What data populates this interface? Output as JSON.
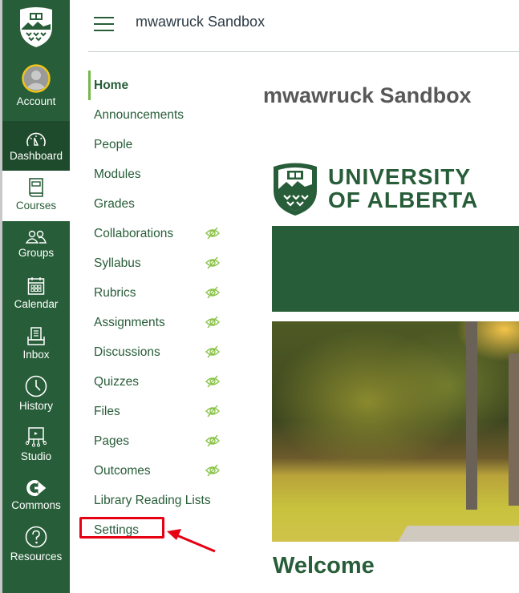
{
  "global_nav": {
    "items": [
      {
        "label": "Account",
        "icon": "avatar-icon"
      },
      {
        "label": "Dashboard",
        "icon": "dashboard-icon"
      },
      {
        "label": "Courses",
        "icon": "courses-icon",
        "active": true
      },
      {
        "label": "Groups",
        "icon": "groups-icon"
      },
      {
        "label": "Calendar",
        "icon": "calendar-icon"
      },
      {
        "label": "Inbox",
        "icon": "inbox-icon"
      },
      {
        "label": "History",
        "icon": "clock-icon"
      },
      {
        "label": "Studio",
        "icon": "studio-icon"
      },
      {
        "label": "Commons",
        "icon": "commons-icon"
      },
      {
        "label": "Resources",
        "icon": "help-icon"
      }
    ]
  },
  "header": {
    "breadcrumb": "mwawruck Sandbox"
  },
  "course_nav": {
    "items": [
      {
        "label": "Home",
        "active": true,
        "hidden": false
      },
      {
        "label": "Announcements",
        "hidden": false
      },
      {
        "label": "People",
        "hidden": false
      },
      {
        "label": "Modules",
        "hidden": false
      },
      {
        "label": "Grades",
        "hidden": false
      },
      {
        "label": "Collaborations",
        "hidden": true
      },
      {
        "label": "Syllabus",
        "hidden": true
      },
      {
        "label": "Rubrics",
        "hidden": true
      },
      {
        "label": "Assignments",
        "hidden": true
      },
      {
        "label": "Discussions",
        "hidden": true
      },
      {
        "label": "Quizzes",
        "hidden": true
      },
      {
        "label": "Files",
        "hidden": true
      },
      {
        "label": "Pages",
        "hidden": true
      },
      {
        "label": "Outcomes",
        "hidden": true
      },
      {
        "label": "Library Reading Lists",
        "hidden": false
      },
      {
        "label": "Settings",
        "hidden": false,
        "highlighted": true
      }
    ]
  },
  "main": {
    "course_title": "mwawruck Sandbox",
    "logo_line1": "UNIVERSITY",
    "logo_line2": "OF ALBERTA",
    "welcome": "Welcome"
  },
  "colors": {
    "brand_green": "#275d38",
    "active_indicator": "#74b94a",
    "highlight_red": "#e60012",
    "hidden_eye": "#8bc34a"
  }
}
